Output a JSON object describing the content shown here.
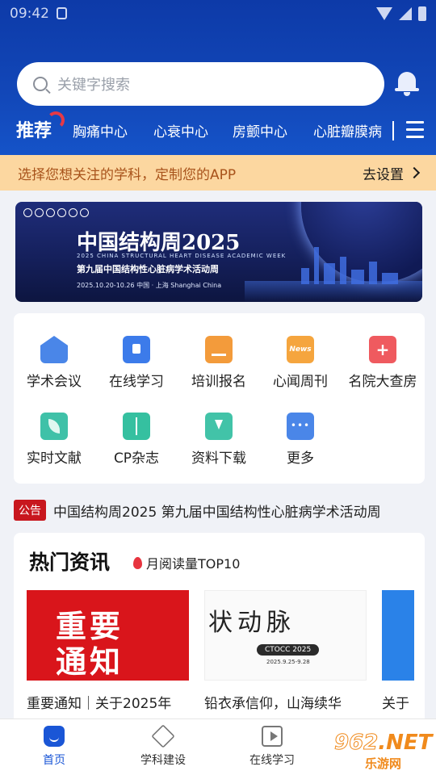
{
  "status_bar": {
    "time": "09:42"
  },
  "search": {
    "placeholder": "关键字搜索"
  },
  "tabs": {
    "active": "推荐",
    "items": [
      "胸痛中心",
      "心衰中心",
      "房颤中心",
      "心脏瓣膜病"
    ]
  },
  "tip_banner": {
    "message": "选择您想关注的学科，定制您的APP",
    "action": "去设置"
  },
  "hero": {
    "title": "中国结构周2025",
    "subtitle_en": "2025 CHINA STRUCTURAL HEART DISEASE ACADEMIC WEEK",
    "subtitle_cn": "第九届中国结构性心脏病学术活动周",
    "date_line": "2025.10.20-10.26  中国 · 上海  Shanghai China"
  },
  "quick_grid": [
    {
      "label": "学术会议",
      "icon": "conference-icon"
    },
    {
      "label": "在线学习",
      "icon": "online-learning-icon"
    },
    {
      "label": "培训报名",
      "icon": "registration-icon"
    },
    {
      "label": "心闻周刊",
      "icon": "news-icon",
      "icon_text": "News"
    },
    {
      "label": "名院大查房",
      "icon": "medical-kit-icon"
    },
    {
      "label": "实时文献",
      "icon": "literature-icon"
    },
    {
      "label": "CP杂志",
      "icon": "journal-icon"
    },
    {
      "label": "资料下载",
      "icon": "download-cloud-icon"
    },
    {
      "label": "更多",
      "icon": "more-icon"
    }
  ],
  "notice": {
    "tag": "公告",
    "text": "中国结构周2025 第九届中国结构性心脏病学术活动周"
  },
  "hot_news": {
    "title": "热门资讯",
    "subtitle": "月阅读量TOP10",
    "cards": [
      {
        "image_text_1": "重要",
        "image_text_2": "通知",
        "caption": "重要通知｜关于2025年"
      },
      {
        "image_text": "状动脉",
        "image_tag": "CTOCC 2025",
        "image_note": "2025.9.25-9.28",
        "caption": "铅衣承信仰，山海续华"
      },
      {
        "caption": "关于"
      }
    ]
  },
  "bottom_nav": [
    {
      "label": "首页",
      "icon": "home-icon"
    },
    {
      "label": "学科建设",
      "icon": "cube-icon"
    },
    {
      "label": "在线学习",
      "icon": "video-icon"
    }
  ],
  "watermark": {
    "number": "962",
    "domain": ".NET",
    "text": "乐游网"
  },
  "colors": {
    "primary": "#1553c8",
    "tip_bg": "#fcd7a0",
    "notice_tag": "#c8171e"
  }
}
